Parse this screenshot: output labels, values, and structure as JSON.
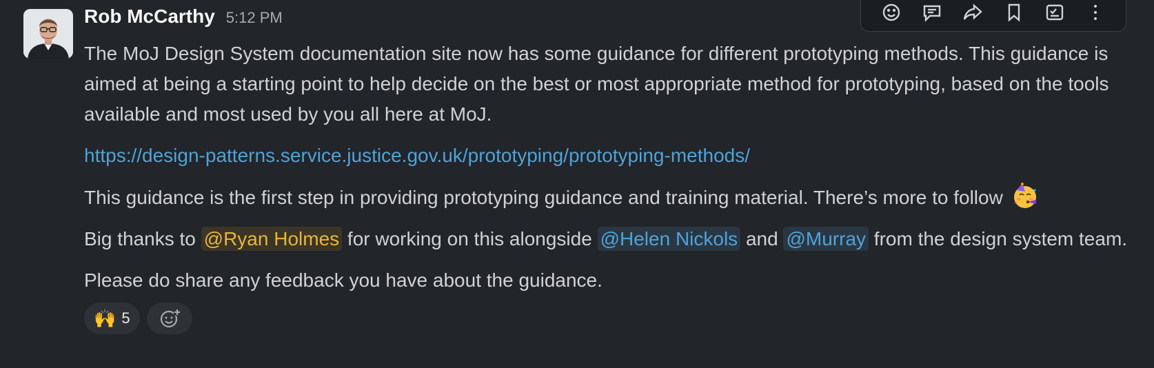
{
  "message": {
    "author": "Rob McCarthy",
    "timestamp": "5:12 PM",
    "p1": "The MoJ Design System documentation site now has some guidance for different prototyping methods. This guidance is aimed at being a starting point to help decide on the best or most appropriate method for prototyping, based on the tools available and most used by you all here at MoJ.",
    "link": "https://design-patterns.service.justice.gov.uk/prototyping/prototyping-methods/",
    "p3": "This guidance is the first step in providing prototyping guidance and training material. There’s more to follow",
    "p3_emoji": "partying-face-icon",
    "p4": {
      "prefix": "Big thanks to ",
      "mention1": "@Ryan Holmes",
      "middle1": " for working on this alongside ",
      "mention2": "@Helen Nickols",
      "middle2": " and ",
      "mention3": "@Murray",
      "suffix": " from the design system team."
    },
    "p5": "Please do share any feedback you have about the guidance."
  },
  "reactions": [
    {
      "emoji": "🙌",
      "count": "5"
    }
  ],
  "toolbar": {
    "icons": [
      "add-reaction-icon",
      "reply-thread-icon",
      "share-icon",
      "bookmark-icon",
      "add-to-list-icon",
      "more-actions-icon"
    ]
  },
  "colors": {
    "background": "#222529",
    "link": "#4fa3d9",
    "self_mention": "#e8b53a"
  }
}
